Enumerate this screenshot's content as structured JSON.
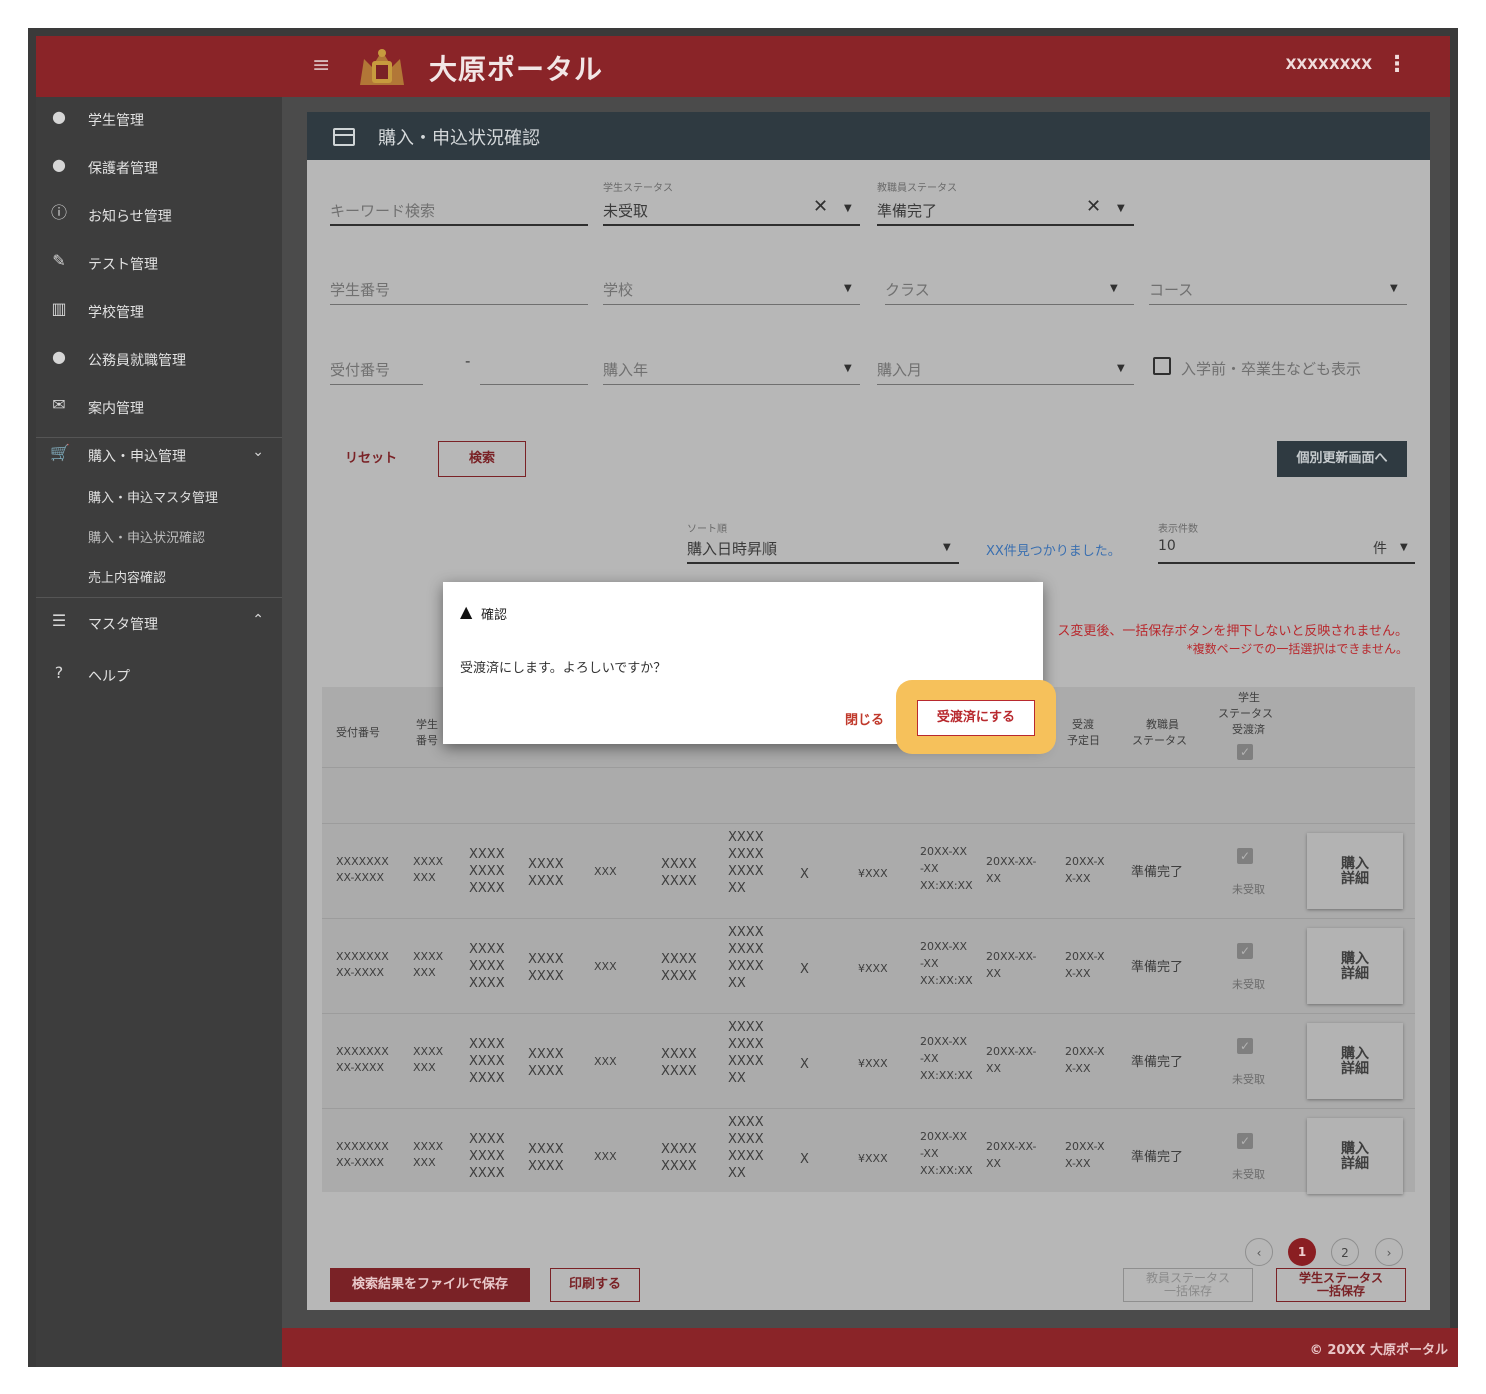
{
  "header": {
    "app_title": "大原ポータル",
    "user": "XXXXXXXX"
  },
  "sidebar": {
    "items": [
      {
        "label": "学生管理",
        "icon": "person-icon"
      },
      {
        "label": "保護者管理",
        "icon": "person-icon"
      },
      {
        "label": "お知らせ管理",
        "icon": "info-icon"
      },
      {
        "label": "テスト管理",
        "icon": "pencil-icon"
      },
      {
        "label": "学校管理",
        "icon": "building-icon"
      },
      {
        "label": "公務員就職管理",
        "icon": "person-icon"
      },
      {
        "label": "案内管理",
        "icon": "mail-icon"
      },
      {
        "label": "購入・申込管理",
        "icon": "cart-icon"
      },
      {
        "label": "マスタ管理",
        "icon": "list-icon"
      },
      {
        "label": "ヘルプ",
        "icon": "help-icon"
      }
    ],
    "sub_items": [
      "購入・申込マスタ管理",
      "購入・申込状況確認",
      "売上内容確認"
    ]
  },
  "page": {
    "title": "購入・申込状況確認"
  },
  "filters": {
    "keyword_placeholder": "キーワード検索",
    "student_status_label": "学生ステータス",
    "student_status_value": "未受取",
    "staff_status_label": "教職員ステータス",
    "staff_status_value": "準備完了",
    "student_number_placeholder": "学生番号",
    "school_placeholder": "学校",
    "class_placeholder": "クラス",
    "course_placeholder": "コース",
    "receipt_number_placeholder": "受付番号",
    "dash": "-",
    "purchase_year_placeholder": "購入年",
    "purchase_month_placeholder": "購入月",
    "show_all_label": "入学前・卒業生なども表示"
  },
  "actions": {
    "reset": "リセット",
    "search": "検索",
    "individual": "個別更新画面へ"
  },
  "sort": {
    "label": "ソート順",
    "value": "購入日時昇順",
    "found": "XX件見つかりました。",
    "count_label": "表示件数",
    "count_value": "10",
    "count_unit": "件"
  },
  "notes": {
    "line1": "ス変更後、一括保存ボタンを押下しないと反映されません。",
    "line2": "*複数ページでの一括選択はできません。"
  },
  "table": {
    "headers": {
      "receipt": "受付番号",
      "student_no_1": "学生",
      "student_no_2": "番号",
      "planned_1": "受渡",
      "planned_2": "予定日",
      "staff_status_1": "教職員",
      "staff_status_2": "ステータス",
      "student_status_1": "学生",
      "student_status_2": "ステータス",
      "student_status_3": "受渡済"
    },
    "rows": [
      {
        "c1a": "XXXXXXX",
        "c1b": "XX-XXXX",
        "c2a": "XXXX",
        "c2b": "XXX",
        "c3": [
          "XXXX",
          "XXXX",
          "XXXX"
        ],
        "c4": [
          "XXXX",
          "XXXX"
        ],
        "c5": "XXX",
        "c6": [
          "XXXX",
          "XXXX"
        ],
        "c7": [
          "XXXX",
          "XXXX",
          "XXXX",
          "XX"
        ],
        "c8": "X",
        "c9": "¥XXX",
        "c10": [
          "20XX-XX",
          "-XX",
          "XX:XX:XX"
        ],
        "c11": [
          "20XX-XX-",
          "XX"
        ],
        "c12": [
          "20XX-X",
          "X-XX"
        ],
        "staff": "準備完了",
        "student": "未受取",
        "detail1": "購入",
        "detail2": "詳細"
      },
      {
        "c1a": "XXXXXXX",
        "c1b": "XX-XXXX",
        "c2a": "XXXX",
        "c2b": "XXX",
        "c3": [
          "XXXX",
          "XXXX",
          "XXXX"
        ],
        "c4": [
          "XXXX",
          "XXXX"
        ],
        "c5": "XXX",
        "c6": [
          "XXXX",
          "XXXX"
        ],
        "c7": [
          "XXXX",
          "XXXX",
          "XXXX",
          "XX"
        ],
        "c8": "X",
        "c9": "¥XXX",
        "c10": [
          "20XX-XX",
          "-XX",
          "XX:XX:XX"
        ],
        "c11": [
          "20XX-XX-",
          "XX"
        ],
        "c12": [
          "20XX-X",
          "X-XX"
        ],
        "staff": "準備完了",
        "student": "未受取",
        "detail1": "購入",
        "detail2": "詳細"
      },
      {
        "c1a": "XXXXXXX",
        "c1b": "XX-XXXX",
        "c2a": "XXXX",
        "c2b": "XXX",
        "c3": [
          "XXXX",
          "XXXX",
          "XXXX"
        ],
        "c4": [
          "XXXX",
          "XXXX"
        ],
        "c5": "XXX",
        "c6": [
          "XXXX",
          "XXXX"
        ],
        "c7": [
          "XXXX",
          "XXXX",
          "XXXX",
          "XX"
        ],
        "c8": "X",
        "c9": "¥XXX",
        "c10": [
          "20XX-XX",
          "-XX",
          "XX:XX:XX"
        ],
        "c11": [
          "20XX-XX-",
          "XX"
        ],
        "c12": [
          "20XX-X",
          "X-XX"
        ],
        "staff": "準備完了",
        "student": "未受取",
        "detail1": "購入",
        "detail2": "詳細"
      },
      {
        "c1a": "XXXXXXX",
        "c1b": "XX-XXXX",
        "c2a": "XXXX",
        "c2b": "XXX",
        "c3": [
          "XXXX",
          "XXXX",
          "XXXX"
        ],
        "c4": [
          "XXXX",
          "XXXX"
        ],
        "c5": "XXX",
        "c6": [
          "XXXX",
          "XXXX"
        ],
        "c7": [
          "XXXX",
          "XXXX",
          "XXXX",
          "XX"
        ],
        "c8": "X",
        "c9": "¥XXX",
        "c10": [
          "20XX-XX",
          "-XX",
          "XX:XX:XX"
        ],
        "c11": [
          "20XX-XX-",
          "XX"
        ],
        "c12": [
          "20XX-X",
          "X-XX"
        ],
        "staff": "準備完了",
        "student": "未受取",
        "detail1": "購入",
        "detail2": "詳細"
      }
    ]
  },
  "pager": {
    "pages": [
      "1",
      "2"
    ],
    "current": "1"
  },
  "bottom": {
    "save_file": "検索結果をファイルで保存",
    "print": "印刷する",
    "staff_bulk_1": "教員ステータス",
    "staff_bulk_2": "一括保存",
    "student_bulk_1": "学生ステータス",
    "student_bulk_2": "一括保存"
  },
  "footer": {
    "copyright": "© 20XX 大原ポータル"
  },
  "dialog": {
    "title": "確認",
    "message": "受渡済にします。よろしいですか？",
    "close": "閉じる",
    "confirm": "受渡済にする"
  },
  "colors": {
    "brand": "#8a2428",
    "panel_head": "#2f3a41",
    "highlight": "#f6c15b",
    "confirm_text": "#b8292e"
  }
}
